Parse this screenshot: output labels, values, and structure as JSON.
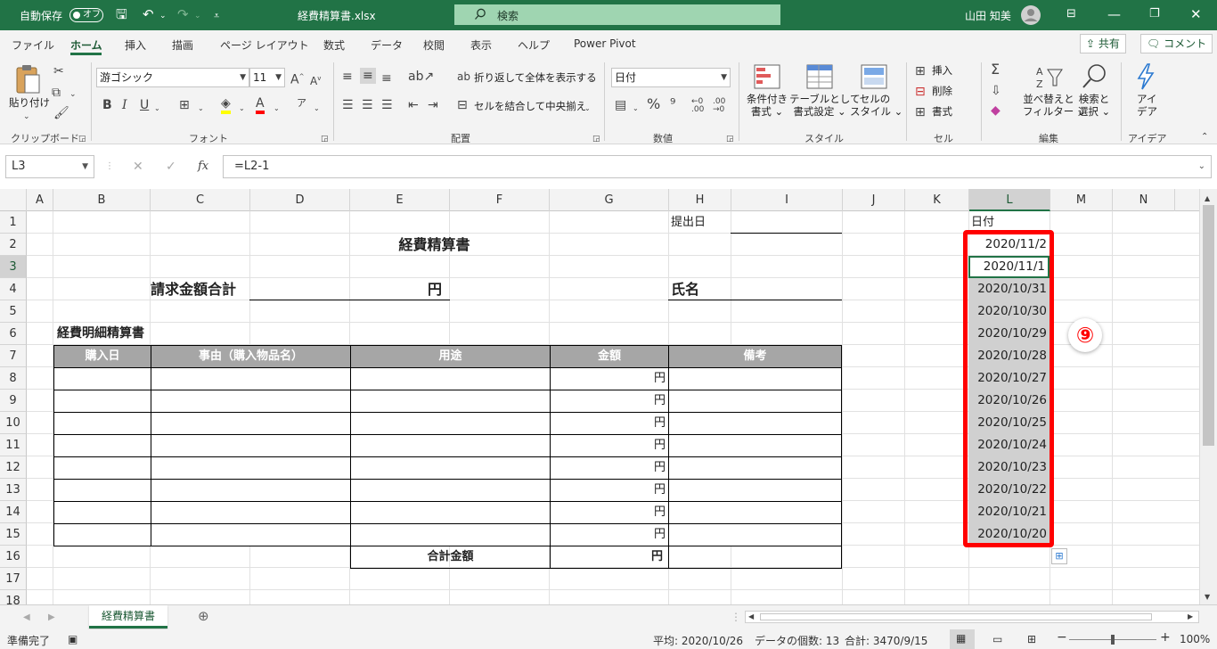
{
  "titlebar": {
    "autosave": "自動保存",
    "autosave_state": "オフ",
    "filename": "経費精算書.xlsx",
    "search": "検索",
    "user": "山田 知美"
  },
  "tabs": [
    "ファイル",
    "ホーム",
    "挿入",
    "描画",
    "ページ レイアウト",
    "数式",
    "データ",
    "校閲",
    "表示",
    "ヘルプ",
    "Power Pivot"
  ],
  "share": "共有",
  "comment": "コメント",
  "ribbon": {
    "paste": "貼り付け",
    "clipboard": "クリップボード",
    "font_name": "游ゴシック",
    "font_size": "11",
    "font_group": "フォント",
    "wrap": "折り返して全体を表示する",
    "merge": "セルを結合して中央揃え",
    "align_group": "配置",
    "number_format": "日付",
    "number_group": "数値",
    "cond_format": [
      "条件付き",
      "書式"
    ],
    "table_format": [
      "テーブルとして",
      "書式設定"
    ],
    "cell_style": [
      "セルの",
      "スタイル"
    ],
    "style_group": "スタイル",
    "insert": "挿入",
    "delete": "削除",
    "format": "書式",
    "cells_group": "セル",
    "sort": [
      "並べ替えと",
      "フィルター"
    ],
    "find": [
      "検索と",
      "選択"
    ],
    "edit_group": "編集",
    "idea": [
      "アイ",
      "デア"
    ],
    "idea_group": "アイデア"
  },
  "formula": {
    "namebox": "L3",
    "content": "=L2-1"
  },
  "columns": [
    "A",
    "B",
    "C",
    "D",
    "E",
    "F",
    "G",
    "H",
    "I",
    "J",
    "K",
    "L",
    "M",
    "N"
  ],
  "rows": [
    "1",
    "2",
    "3",
    "4",
    "5",
    "6",
    "7",
    "8",
    "9",
    "10",
    "11",
    "12",
    "13",
    "14",
    "15",
    "16",
    "17",
    "18"
  ],
  "sheet": {
    "submit_date_label": "提出日",
    "title": "経費精算書",
    "total_label": "請求金額合計",
    "yen": "円",
    "name_label": "氏名",
    "detail_title": "経費明細精算書",
    "headers": [
      "購入日",
      "事由（購入物品名）",
      "用途",
      "金額",
      "備考"
    ],
    "sum_label": "合計金額",
    "date_header": "日付",
    "dates": [
      "2020/11/2",
      "2020/11/1",
      "2020/10/31",
      "2020/10/30",
      "2020/10/29",
      "2020/10/28",
      "2020/10/27",
      "2020/10/26",
      "2020/10/25",
      "2020/10/24",
      "2020/10/23",
      "2020/10/22",
      "2020/10/21",
      "2020/10/20"
    ],
    "callout": "⑨"
  },
  "sheet_tab": "経費精算書",
  "status": {
    "ready": "準備完了",
    "average": "平均: 2020/10/26",
    "count": "データの個数: 13",
    "sum": "合計: 3470/9/15",
    "zoom": "100%"
  },
  "colors": {
    "accent": "#217346",
    "highlight": "#ff0000"
  }
}
